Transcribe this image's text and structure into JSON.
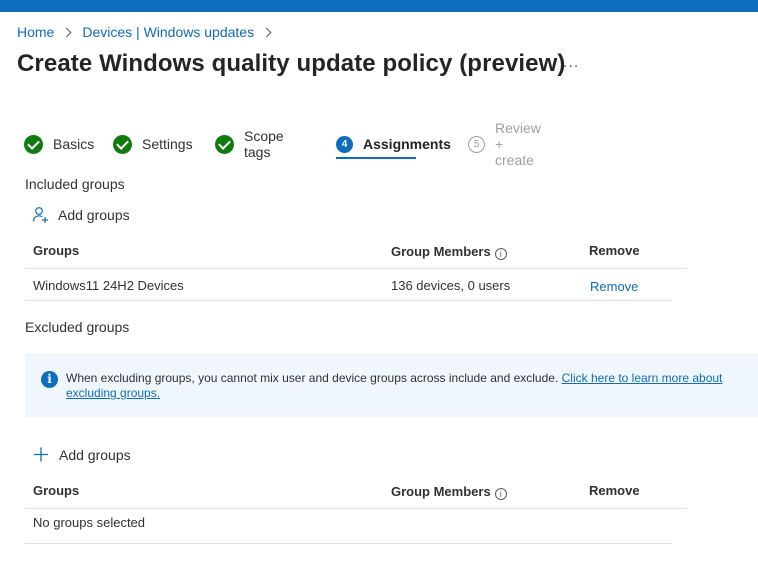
{
  "breadcrumb": {
    "home": "Home",
    "devices": "Devices | Windows updates"
  },
  "page": {
    "title": "Create Windows quality update policy (preview)",
    "more": "..."
  },
  "steps": [
    {
      "label": "Basics",
      "state": "done"
    },
    {
      "label": "Settings",
      "state": "done"
    },
    {
      "label": "Scope tags",
      "state": "done"
    },
    {
      "num": "4",
      "label": "Assignments",
      "state": "active"
    },
    {
      "num": "5",
      "label": "Review + create",
      "state": "disabled"
    }
  ],
  "included": {
    "title": "Included groups",
    "add_label": "Add groups",
    "columns": {
      "groups": "Groups",
      "members": "Group Members",
      "remove": "Remove"
    },
    "rows": [
      {
        "group": "Windows11 24H2 Devices",
        "members": "136 devices, 0 users",
        "action": "Remove"
      }
    ]
  },
  "excluded": {
    "title": "Excluded groups",
    "banner_text": "When excluding groups, you cannot mix user and device groups across include and exclude.",
    "banner_link": "Click here to learn more about excluding groups.",
    "add_label": "Add groups",
    "columns": {
      "groups": "Groups",
      "members": "Group Members",
      "remove": "Remove"
    },
    "empty": "No groups selected"
  },
  "colors": {
    "accent": "#0f6cbd",
    "success": "#107c10",
    "banner_bg": "#eff6fc"
  }
}
